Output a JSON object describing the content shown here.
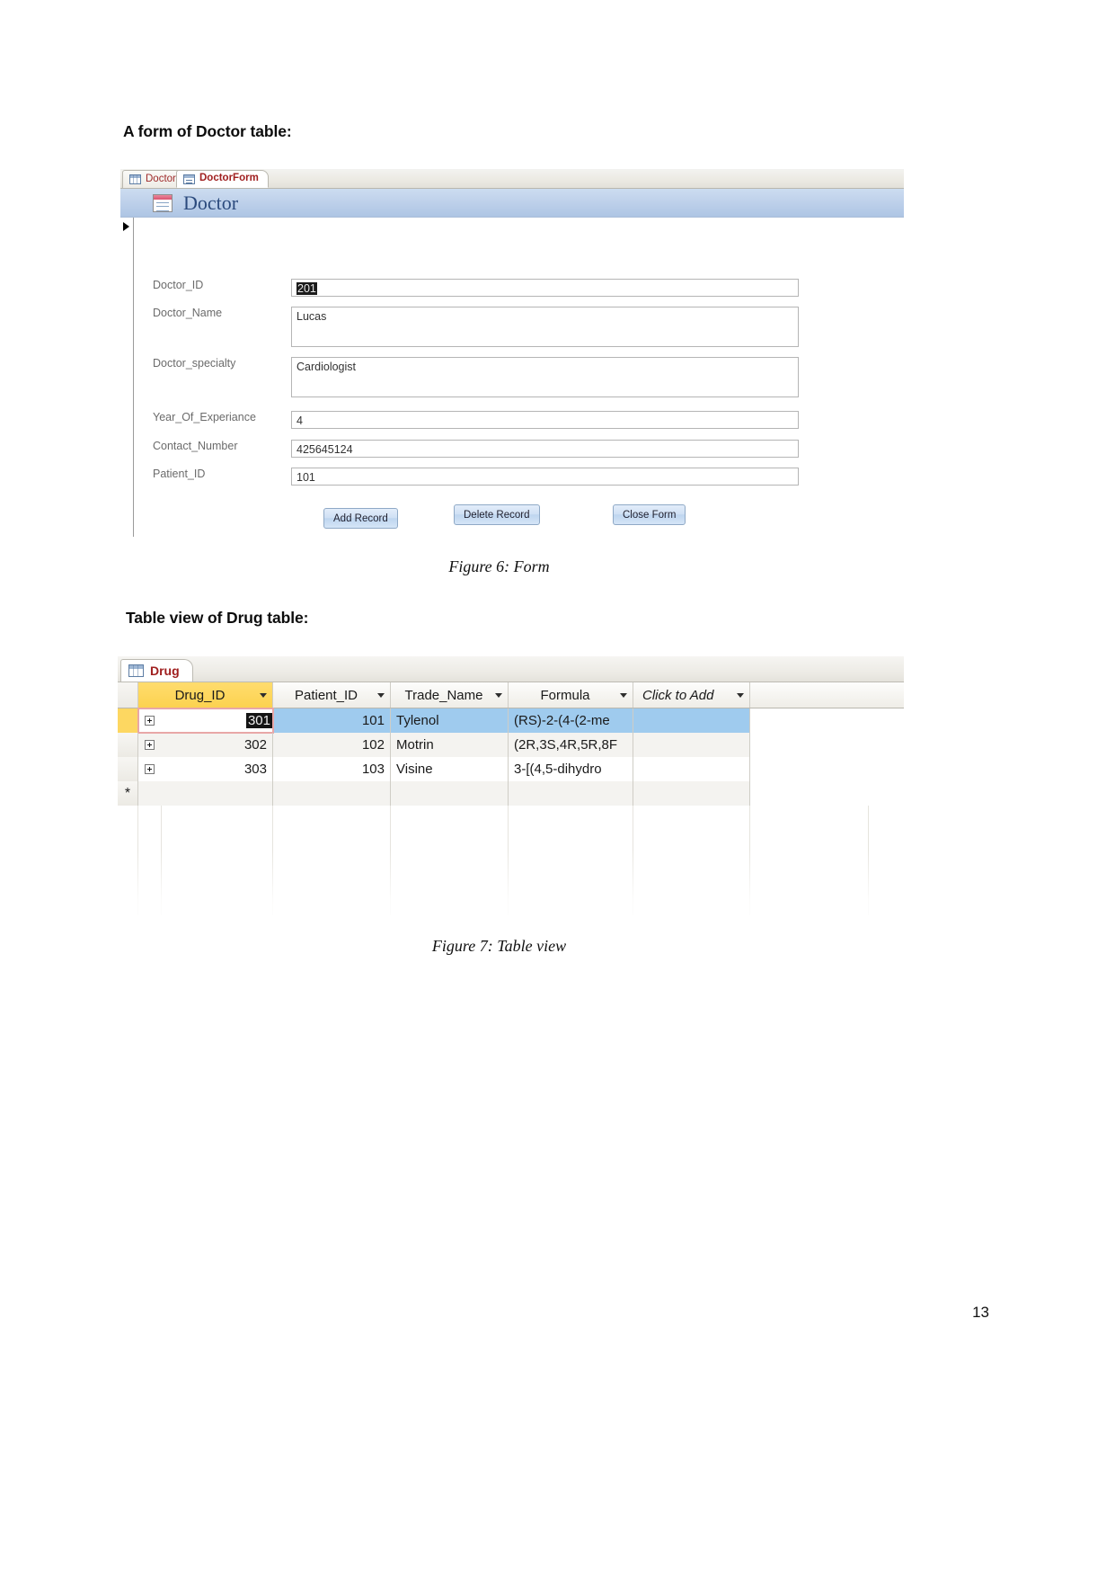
{
  "document": {
    "heading_form": "A form of Doctor table:",
    "heading_table": "Table view of Drug table:",
    "caption_form": "Figure 6: Form",
    "caption_table": "Figure 7: Table view",
    "page_number": "13"
  },
  "form_window": {
    "tabs": [
      {
        "label": "Doctor",
        "icon": "table-icon",
        "active": false
      },
      {
        "label": "DoctorForm",
        "icon": "form-icon",
        "active": true
      }
    ],
    "header_title": "Doctor",
    "header_icon": "form-icon",
    "fields": [
      {
        "label": "Doctor_ID",
        "value": "201",
        "selected": true
      },
      {
        "label": "Doctor_Name",
        "value": "Lucas",
        "selected": false
      },
      {
        "label": "Doctor_specialty",
        "value": "Cardiologist",
        "selected": false
      },
      {
        "label": "Year_Of_Experiance",
        "value": "4",
        "selected": false
      },
      {
        "label": "Contact_Number",
        "value": "425645124",
        "selected": false
      },
      {
        "label": "Patient_ID",
        "value": "101",
        "selected": false
      }
    ],
    "buttons": [
      {
        "label": "Add Record"
      },
      {
        "label": "Delete Record"
      },
      {
        "label": "Close Form"
      }
    ]
  },
  "table_window": {
    "tab": {
      "label": "Drug",
      "icon": "table-icon"
    },
    "columns": [
      {
        "label": "Drug_ID",
        "current": true
      },
      {
        "label": "Patient_ID",
        "current": false
      },
      {
        "label": "Trade_Name",
        "current": false
      },
      {
        "label": "Formula",
        "current": false
      },
      {
        "label": "Click to Add",
        "current": false
      }
    ],
    "rows": [
      {
        "drug_id": "301",
        "patient_id": "101",
        "trade_name": "Tylenol",
        "formula": "(RS)-2-(4-(2-me",
        "selected": true,
        "editing": true
      },
      {
        "drug_id": "302",
        "patient_id": "102",
        "trade_name": "Motrin",
        "formula": "(2R,3S,4R,5R,8F",
        "selected": false,
        "editing": false
      },
      {
        "drug_id": "303",
        "patient_id": "103",
        "trade_name": "Visine",
        "formula": "3-[(4,5-dihydro",
        "selected": false,
        "editing": false
      }
    ],
    "new_row_marker": "*"
  },
  "colors": {
    "tab_text": "#a02020",
    "form_header_bg": "#bdd0ea",
    "form_title": "#2b4a7d",
    "current_column": "#fcd24f",
    "selected_row": "#9fcbee"
  }
}
